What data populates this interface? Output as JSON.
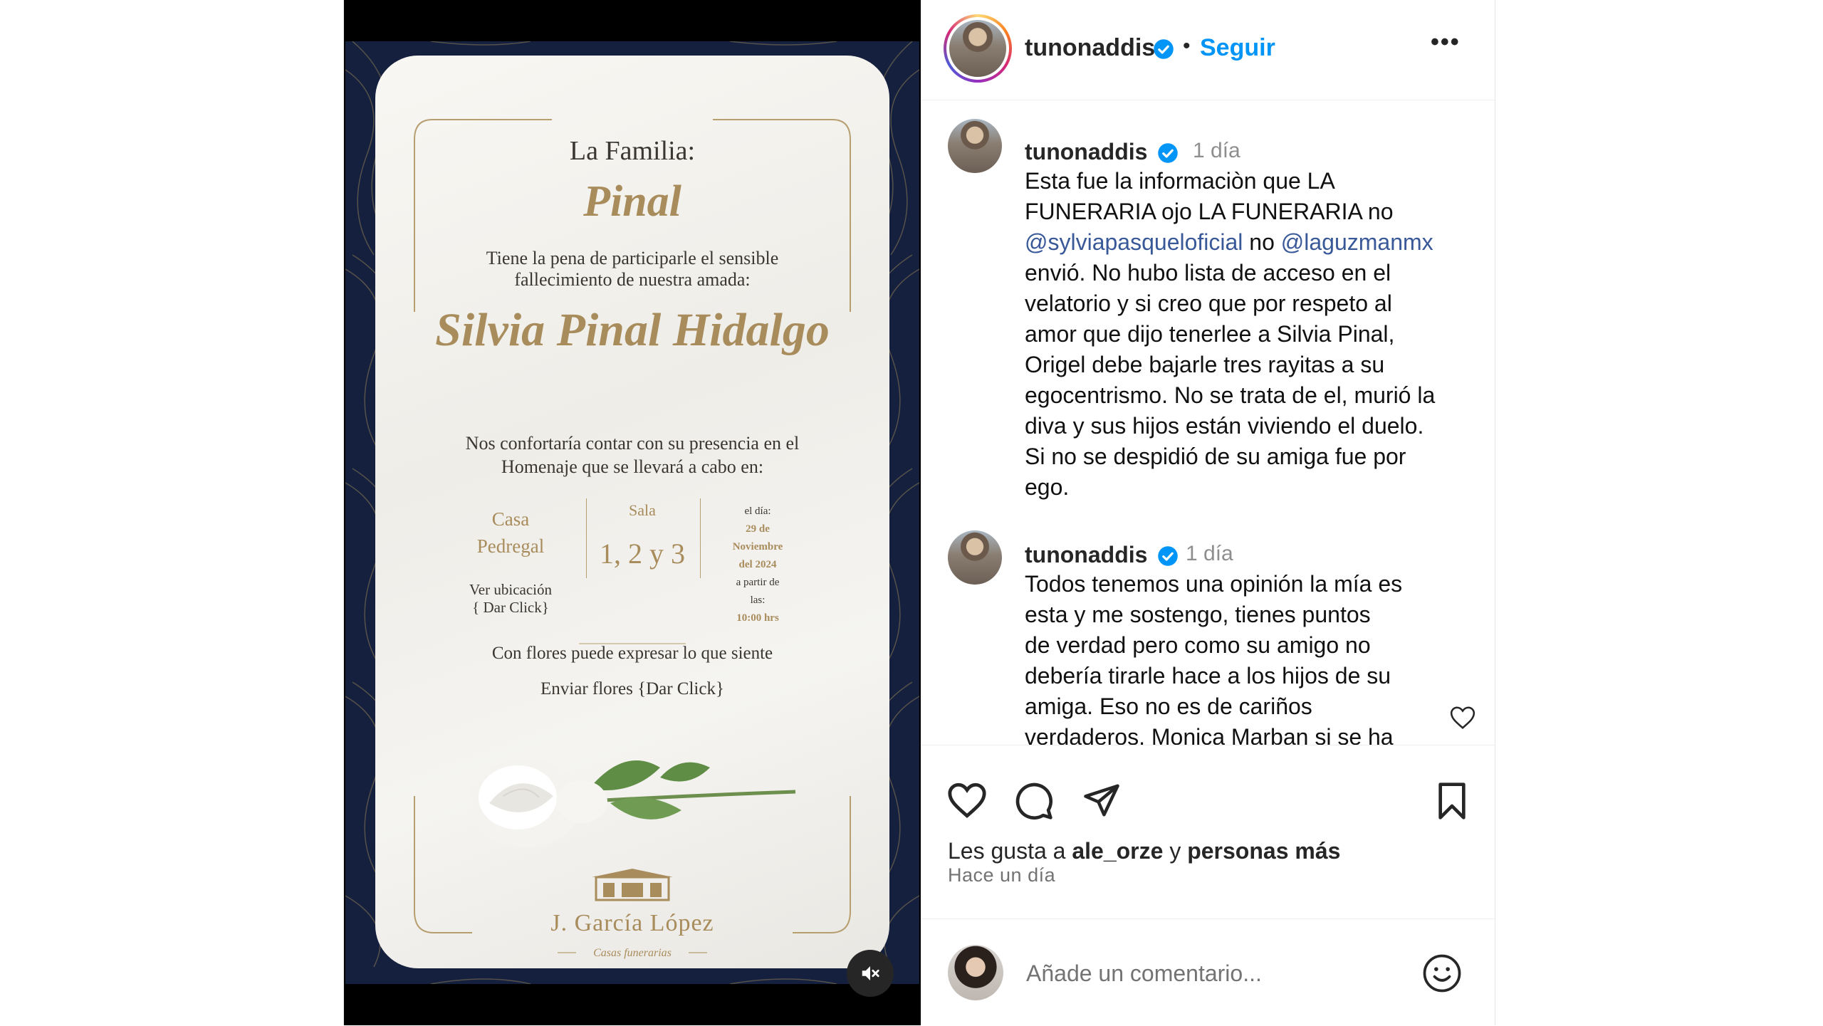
{
  "media": {
    "familia_label": "La Familia:",
    "familia_name": "Pinal",
    "pena_line1": "Tiene la pena de participarle el sensible",
    "pena_line2": "fallecimiento de nuestra amada:",
    "deceased": "Silvia Pinal Hidalgo",
    "conf_line1": "Nos confortaría contar con su presencia en el",
    "conf_line2": "Homenaje que se llevará a cabo en:",
    "casa_line1": "Casa",
    "casa_line2": "Pedregal",
    "ubic_line1": "Ver ubicación",
    "ubic_line2": "{ Dar Click}",
    "sala_label": "Sala",
    "sala_numbers": "1, 2 y 3",
    "dia_label": "el día:",
    "dia_date1": "29 de",
    "dia_date2": "Noviembre",
    "dia_date3": "del 2024",
    "dia_from1": "a partir de",
    "dia_from2": "las:",
    "dia_time": "10:00 hrs",
    "flores_line": "Con flores puede expresar lo que siente",
    "enviar_line": "Enviar flores  {Dar Click}",
    "funeral_home": "J. García López",
    "funeral_sub": "Casas funerarias",
    "mute_icon": "speaker-muted-icon"
  },
  "header": {
    "username": "tunonaddis",
    "separator": "•",
    "follow_label": "Seguir",
    "more_label": "•••"
  },
  "comments": [
    {
      "username": "tunonaddis",
      "time": "1 día",
      "lines": [
        "Esta fue la informaciòn que LA",
        "FUNERARIA ojo LA FUNERARIA no",
        "",
        "envió. No hubo lista de acceso en el",
        "velatorio y si creo que por respeto al",
        "amor que dijo tenerlee a Silvia Pinal,",
        "Origel debe bajarle tres rayitas a su",
        "egocentrismo. No se trata de el, murió la",
        "diva y sus hijos están viviendo el duelo.",
        "Si no se despidió de su amiga fue por",
        "ego."
      ],
      "mention1": "@sylviapasqueloficial",
      "mention_join": " no ",
      "mention2": "@laguzmanmx"
    },
    {
      "username": "tunonaddis",
      "time": "1 día",
      "lines": [
        "Todos tenemos una opinión la mía es",
        "esta y me sostengo, tienes puntos",
        "de verdad pero como su amigo no",
        "debería tirarle hace a los hijos de su",
        "amiga. Eso no es de cariños",
        "verdaderos. Monica Marban si se ha"
      ]
    }
  ],
  "likes": {
    "prefix": "Les gusta a ",
    "user": "ale_orze",
    "middle": " y ",
    "rest": "personas más"
  },
  "ago": "Hace un día",
  "add_comment": {
    "placeholder": "Añade un comentario..."
  },
  "colors": {
    "link_blue": "#0095f6",
    "mention_blue": "#385898",
    "gold": "#a88c5c",
    "navy": "#14203d"
  }
}
